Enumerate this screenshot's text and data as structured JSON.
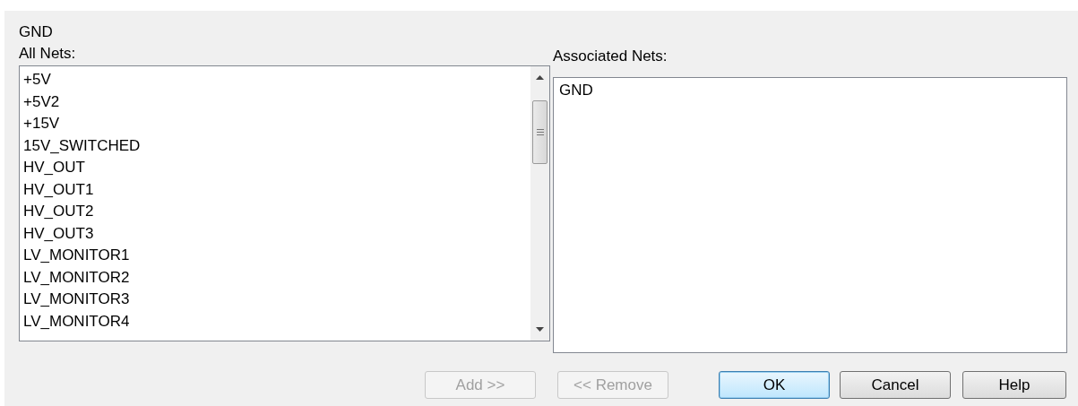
{
  "net_name": "GND",
  "all_nets": {
    "label": "All Nets:",
    "items": [
      {
        "label": "+5V",
        "selected": false
      },
      {
        "label": "+5V2",
        "selected": false
      },
      {
        "label": "+15V",
        "selected": false
      },
      {
        "label": "15V_SWITCHED",
        "selected": false
      },
      {
        "label": "HV_OUT",
        "selected": false
      },
      {
        "label": "HV_OUT1",
        "selected": false
      },
      {
        "label": "HV_OUT2",
        "selected": false
      },
      {
        "label": "HV_OUT3",
        "selected": false
      },
      {
        "label": "LV_MONITOR1",
        "selected": false
      },
      {
        "label": "LV_MONITOR2",
        "selected": false
      },
      {
        "label": "LV_MONITOR3",
        "selected": false
      },
      {
        "label": "LV_MONITOR4",
        "selected": false
      }
    ]
  },
  "associated_nets": {
    "label": "Associated Nets:",
    "items": [
      {
        "label": "GND",
        "selected": false
      }
    ]
  },
  "buttons": [
    {
      "label": "Add >>",
      "disabled": true,
      "default": false
    },
    {
      "label": "<< Remove",
      "disabled": true,
      "default": false
    },
    {
      "label": "OK",
      "disabled": false,
      "default": true
    },
    {
      "label": "Cancel",
      "disabled": false,
      "default": false
    },
    {
      "label": "Help",
      "disabled": false,
      "default": false
    }
  ]
}
